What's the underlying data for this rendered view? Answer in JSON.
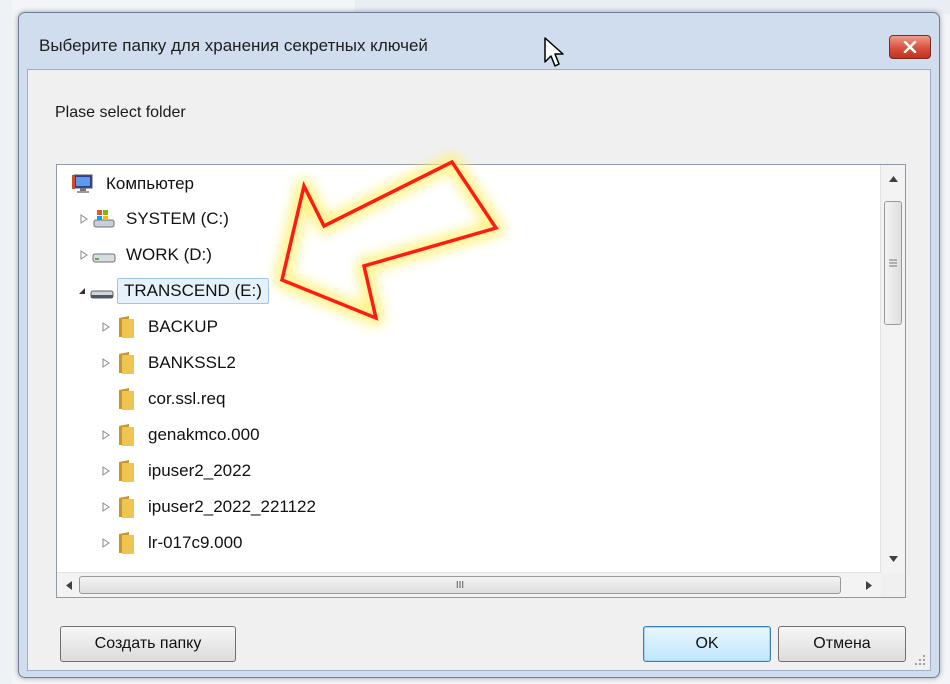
{
  "dialog": {
    "title": "Выберите папку для хранения секретных ключей",
    "prompt": "Plase select folder",
    "close_label": "✕"
  },
  "tree": {
    "items": [
      {
        "label": "Компьютер",
        "icon": "computer-icon",
        "expander": "none",
        "level": 0
      },
      {
        "label": "SYSTEM (C:)",
        "icon": "system-drive-icon",
        "expander": "collapsed",
        "level": 1
      },
      {
        "label": "WORK (D:)",
        "icon": "drive-icon",
        "expander": "collapsed",
        "level": 1
      },
      {
        "label": "TRANSCEND (E:)",
        "icon": "removable-drive-icon",
        "expander": "expanded",
        "level": 1,
        "selected": true
      },
      {
        "label": "BACKUP",
        "icon": "folder-icon",
        "expander": "collapsed",
        "level": 2
      },
      {
        "label": "BANKSSL2",
        "icon": "folder-icon",
        "expander": "collapsed",
        "level": 2
      },
      {
        "label": "cor.ssl.req",
        "icon": "folder-icon",
        "expander": "none",
        "level": 2
      },
      {
        "label": "genakmco.000",
        "icon": "folder-icon",
        "expander": "collapsed",
        "level": 2
      },
      {
        "label": "ipuser2_2022",
        "icon": "folder-icon",
        "expander": "collapsed",
        "level": 2
      },
      {
        "label": "ipuser2_2022_221122",
        "icon": "folder-icon",
        "expander": "collapsed",
        "level": 2
      },
      {
        "label": "lr-017c9.000",
        "icon": "folder-icon",
        "expander": "collapsed",
        "level": 2
      }
    ],
    "hscroll_grip": "III"
  },
  "buttons": {
    "create_folder": "Создать папку",
    "ok": "OK",
    "cancel": "Отмена"
  },
  "colors": {
    "dialog_frame": "#cfddee",
    "close_button": "#d9503c",
    "annotation_arrow": "#ff1a1a",
    "annotation_glow": "#fff27a",
    "folder": "#e8b84a"
  }
}
